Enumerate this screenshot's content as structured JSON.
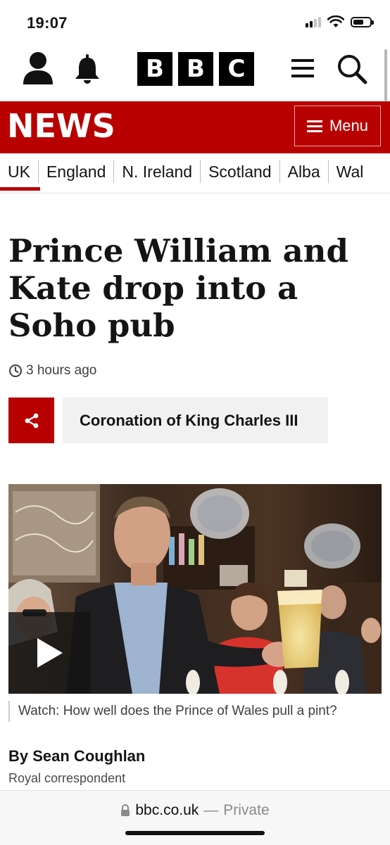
{
  "status_bar": {
    "time": "19:07",
    "signal_bars": 2,
    "battery_level": 0.65
  },
  "header": {
    "logo_letters": [
      "B",
      "B",
      "C"
    ],
    "icons": [
      "account-icon",
      "bell-icon",
      "hamburger-icon",
      "search-icon"
    ]
  },
  "news_bar": {
    "title": "NEWS",
    "menu_label": "Menu",
    "color": "#b80000"
  },
  "region_nav": {
    "items": [
      "UK",
      "England",
      "N. Ireland",
      "Scotland",
      "Alba",
      "Wal"
    ],
    "active": "UK"
  },
  "article": {
    "headline": "Prince William and Kate drop into a Soho pub",
    "timestamp": "3 hours ago",
    "topic": "Coronation of King Charles III",
    "video_caption": "Watch: How well does the Prince of Wales pull a pint?",
    "author": "By Sean Coughlan",
    "author_role": "Royal correspondent"
  },
  "browser": {
    "domain": "bbc.co.uk",
    "separator": "—",
    "mode": "Private"
  }
}
